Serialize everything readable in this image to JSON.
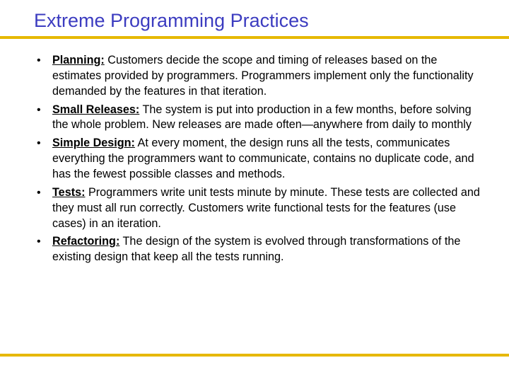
{
  "title": "Extreme Programming Practices",
  "items": [
    {
      "label": "Planning:",
      "text": " Customers decide the scope and timing of releases based on the estimates provided by programmers. Programmers implement only the functionality demanded by the features in that iteration."
    },
    {
      "label": "Small Releases:",
      "text": " The system is put into production in a few months, before solving the whole problem. New releases are made often—anywhere from daily to monthly"
    },
    {
      "label": "Simple Design:",
      "text": " At every moment, the design runs all the tests, communicates everything the programmers want to communicate, contains no duplicate code, and has the fewest possible classes and methods."
    },
    {
      "label": "Tests:",
      "text": " Programmers write unit tests minute by minute. These tests are collected and they must all run correctly. Customers write functional tests for the features (use cases) in an iteration."
    },
    {
      "label": "Refactoring:",
      "text": " The design of the system is evolved through transformations of the existing design that keep all the tests running."
    }
  ]
}
